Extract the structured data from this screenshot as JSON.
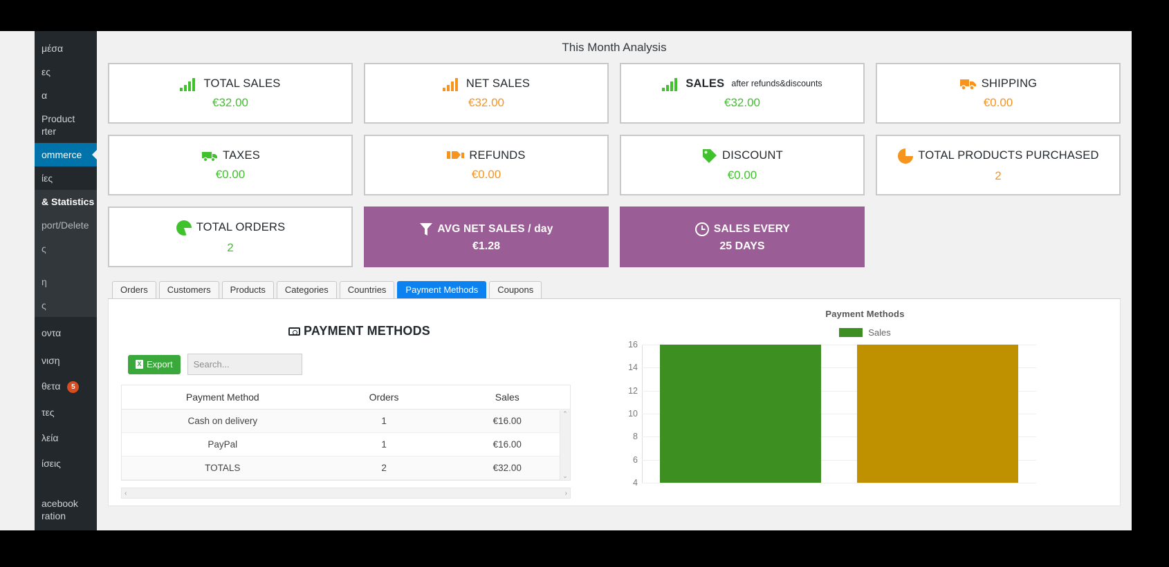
{
  "header": {
    "title": "This Month Analysis"
  },
  "sidebar": {
    "items": [
      {
        "label": "μέσα",
        "type": "normal"
      },
      {
        "label": "ες",
        "type": "normal"
      },
      {
        "label": "α",
        "type": "normal"
      },
      {
        "label": "Product",
        "type": "normal"
      },
      {
        "label": "rter",
        "type": "normal-cont"
      },
      {
        "label": "ommerce",
        "type": "current"
      },
      {
        "label": "ίες",
        "type": "normal"
      },
      {
        "label": "& Statistics",
        "type": "bold"
      },
      {
        "label": "port/Delete",
        "type": "sub"
      },
      {
        "label": "ς",
        "type": "sub"
      },
      {
        "label": "η",
        "type": "sub"
      },
      {
        "label": "ς",
        "type": "sub"
      },
      {
        "label": "οντα",
        "type": "normal"
      },
      {
        "label": "νιση",
        "type": "normal"
      },
      {
        "label": "θετα",
        "type": "normal",
        "badge": "5"
      },
      {
        "label": "τες",
        "type": "normal"
      },
      {
        "label": "λεία",
        "type": "normal"
      },
      {
        "label": "ίσεις",
        "type": "normal"
      },
      {
        "label": "acebook",
        "type": "normal"
      },
      {
        "label": "ration",
        "type": "normal-cont"
      }
    ]
  },
  "kpis": [
    {
      "name": "total-sales",
      "icon": "bar-chart-green",
      "label": "TOTAL SALES",
      "sub": "",
      "value": "€32.00",
      "value_color": "green",
      "style": "white"
    },
    {
      "name": "net-sales",
      "icon": "bar-chart-orange",
      "label": "NET SALES",
      "sub": "",
      "value": "€32.00",
      "value_color": "orange",
      "style": "white"
    },
    {
      "name": "sales-after",
      "icon": "bar-chart-green",
      "label": "SALES",
      "sub": "after refunds&discounts",
      "value": "€32.00",
      "value_color": "green",
      "style": "white"
    },
    {
      "name": "shipping",
      "icon": "truck-orange",
      "label": "SHIPPING",
      "sub": "",
      "value": "€0.00",
      "value_color": "orange",
      "style": "white"
    },
    {
      "name": "taxes",
      "icon": "truck-green",
      "label": "TAXES",
      "sub": "",
      "value": "€0.00",
      "value_color": "green",
      "style": "white"
    },
    {
      "name": "refunds",
      "icon": "refund-orange",
      "label": "REFUNDS",
      "sub": "",
      "value": "€0.00",
      "value_color": "orange",
      "style": "white"
    },
    {
      "name": "discount",
      "icon": "tag-green",
      "label": "DISCOUNT",
      "sub": "",
      "value": "€0.00",
      "value_color": "green",
      "style": "white"
    },
    {
      "name": "total-products-purchased",
      "icon": "pie-orange",
      "label": "TOTAL PRODUCTS PURCHASED",
      "sub": "",
      "value": "2",
      "value_color": "orange",
      "style": "white"
    },
    {
      "name": "total-orders",
      "icon": "pie-green",
      "label": "TOTAL ORDERS",
      "sub": "",
      "value": "2",
      "value_color": "green",
      "style": "white"
    },
    {
      "name": "avg-net-sales-per-day",
      "icon": "funnel-white",
      "label": "AVG NET SALES / day",
      "sub": "",
      "value": "€1.28",
      "value_color": "white",
      "style": "purple"
    },
    {
      "name": "sales-every",
      "icon": "clock-white",
      "label": "SALES EVERY",
      "sub": "",
      "value": "25 DAYS",
      "value_color": "white",
      "style": "purple"
    }
  ],
  "tabs": [
    {
      "label": "Orders",
      "active": false
    },
    {
      "label": "Customers",
      "active": false
    },
    {
      "label": "Products",
      "active": false
    },
    {
      "label": "Categories",
      "active": false
    },
    {
      "label": "Countries",
      "active": false
    },
    {
      "label": "Payment Methods",
      "active": true
    },
    {
      "label": "Coupons",
      "active": false
    }
  ],
  "panel": {
    "heading": "PAYMENT METHODS",
    "export_label": "Export",
    "export_icon_glyph": "X",
    "search_placeholder": "Search...",
    "search_value": "",
    "scroll_up_glyph": "⌃",
    "scroll_down_glyph": "⌄",
    "hscroll_left_glyph": "‹",
    "hscroll_right_glyph": "›",
    "table": {
      "columns": [
        "Payment Method",
        "Orders",
        "Sales"
      ],
      "rows": [
        [
          "Cash on delivery",
          "1",
          "€16.00"
        ],
        [
          "PayPal",
          "1",
          "€16.00"
        ]
      ],
      "totals": [
        "TOTALS",
        "2",
        "€32.00"
      ]
    }
  },
  "chart_data": {
    "type": "bar",
    "title": "Payment Methods",
    "legend": [
      {
        "name": "Sales",
        "color": "#3d8f21"
      }
    ],
    "legend_position": "top-center",
    "categories": [
      "Cash on delivery",
      "PayPal"
    ],
    "series": [
      {
        "name": "Sales",
        "values": [
          16,
          16
        ]
      }
    ],
    "bar_colors": [
      "#3d8f21",
      "#bf9000"
    ],
    "xlabel": "",
    "ylabel": "",
    "ylim": [
      4,
      16
    ],
    "yticks": [
      16,
      14,
      12,
      10,
      8,
      6,
      4
    ],
    "grid": true
  },
  "colors": {
    "green": "#3fc22b",
    "orange": "#f7941e",
    "purple": "#9b5d96",
    "tab_active": "#0b82f0",
    "wp_current": "#0073aa",
    "badge": "#d54e21",
    "export_green": "#3aa83a"
  }
}
